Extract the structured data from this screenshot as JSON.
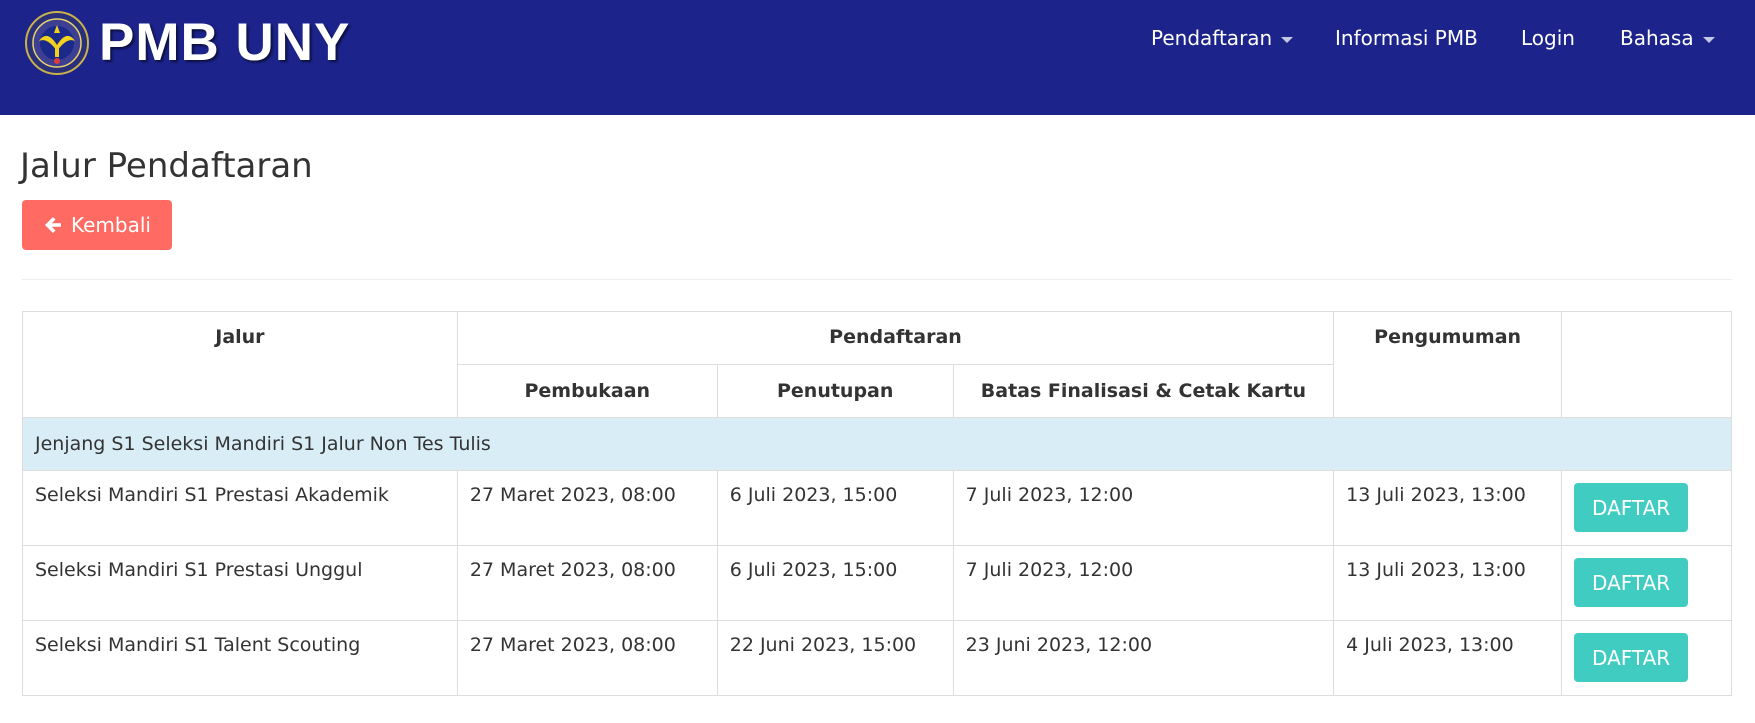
{
  "brand": {
    "name": "PMB UNY"
  },
  "nav": {
    "pendaftaran": "Pendaftaran",
    "informasi": "Informasi PMB",
    "login": "Login",
    "bahasa": "Bahasa"
  },
  "page": {
    "title": "Jalur Pendaftaran",
    "back_label": "Kembali"
  },
  "table": {
    "headers": {
      "jalur": "Jalur",
      "pendaftaran": "Pendaftaran",
      "pengumuman": "Pengumuman",
      "pembukaan": "Pembukaan",
      "penutupan": "Penutupan",
      "batas": "Batas Finalisasi & Cetak Kartu"
    },
    "group": "Jenjang S1 Seleksi Mandiri S1 Jalur Non Tes Tulis",
    "rows": [
      {
        "jalur": "Seleksi Mandiri S1 Prestasi Akademik",
        "pembukaan": "27 Maret 2023, 08:00",
        "penutupan": "6 Juli 2023, 15:00",
        "batas": "7 Juli 2023, 12:00",
        "pengumuman": "13 Juli 2023, 13:00",
        "action": "DAFTAR"
      },
      {
        "jalur": "Seleksi Mandiri S1 Prestasi Unggul",
        "pembukaan": "27 Maret 2023, 08:00",
        "penutupan": "6 Juli 2023, 15:00",
        "batas": "7 Juli 2023, 12:00",
        "pengumuman": "13 Juli 2023, 13:00",
        "action": "DAFTAR"
      },
      {
        "jalur": "Seleksi Mandiri S1 Talent Scouting",
        "pembukaan": "27 Maret 2023, 08:00",
        "penutupan": "22 Juni 2023, 15:00",
        "batas": "23 Juni 2023, 12:00",
        "pengumuman": "4 Juli 2023, 13:00",
        "action": "DAFTAR"
      }
    ]
  },
  "colors": {
    "navbar": "#1c238b",
    "back_button": "#ff6b63",
    "daftar_button": "#41ccc2",
    "group_row": "#d9edf7"
  },
  "icons": {
    "logo": "university-seal-logo",
    "back": "arrow-left-icon",
    "dropdown": "caret-down-icon"
  }
}
